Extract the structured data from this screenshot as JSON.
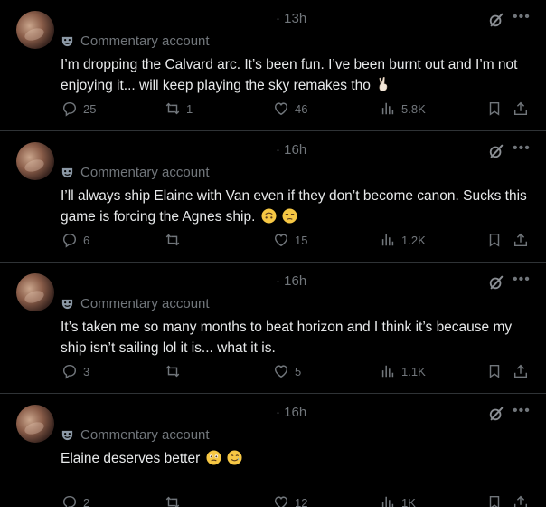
{
  "posts": [
    {
      "time": "· 13h",
      "account_label": "Commentary account",
      "text": "I’m dropping the Calvard arc. It’s been fun. I’ve been burnt out and I’m not enjoying it... will keep playing the sky remakes tho",
      "emojis": [
        "victory-hand"
      ],
      "replies": "25",
      "reposts": "1",
      "likes": "46",
      "views": "5.8K"
    },
    {
      "time": "· 16h",
      "account_label": "Commentary account",
      "text": "I’ll always ship Elaine with Van even if they don’t become canon. Sucks this game is forcing the Agnes ship.",
      "emojis": [
        "upside-down-face",
        "unamused-face"
      ],
      "replies": "6",
      "reposts": "",
      "likes": "15",
      "views": "1.2K"
    },
    {
      "time": "· 16h",
      "account_label": "Commentary account",
      "text": "It’s taken me so many months to beat horizon and I think it’s because my ship isn’t sailing lol it is... what it is.",
      "emojis": [],
      "replies": "3",
      "reposts": "",
      "likes": "5",
      "views": "1.1K"
    },
    {
      "time": "· 16h",
      "account_label": "Commentary account",
      "text": "Elaine deserves better",
      "emojis": [
        "face-holding-back-tears",
        "smiling-face-with-tear"
      ],
      "replies": "2",
      "reposts": "",
      "likes": "12",
      "views": "1K"
    }
  ],
  "colors": {
    "background": "#000000",
    "text": "#e7e9ea",
    "muted": "#71767b",
    "divider": "#2f3336"
  }
}
